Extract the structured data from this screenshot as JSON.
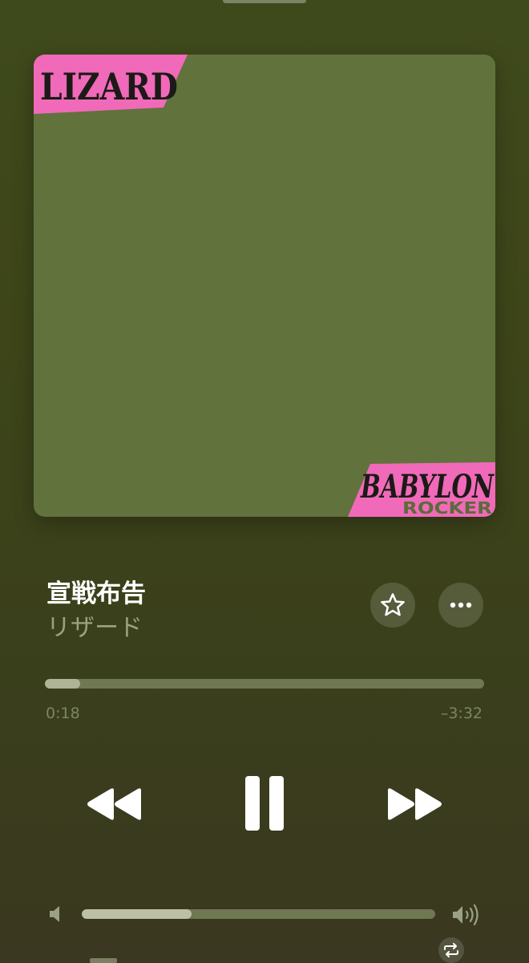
{
  "track": {
    "title": "宣戦布告",
    "artist": "リザード"
  },
  "artwork": {
    "top_label": "LIZARD",
    "bottom_label_1": "BABYLON",
    "bottom_label_2": "ROCKER",
    "background_color": "#61723c",
    "accent_color": "#f06ab9",
    "ink_color": "#1c1a17"
  },
  "playback": {
    "elapsed": "0:18",
    "remaining": "–3:32",
    "progress_fraction": 0.08,
    "state": "playing"
  },
  "volume": {
    "level_fraction": 0.31
  },
  "icons": {
    "favorite": "star-icon",
    "more": "ellipsis-icon",
    "rewind": "rewind-icon",
    "pause": "pause-icon",
    "forward": "fast-forward-icon",
    "volume_min": "speaker-icon",
    "volume_max": "speaker-wave-icon",
    "repeat": "repeat-icon"
  },
  "colors": {
    "background": "#3f4a1c",
    "title": "#ffffff",
    "subtitle": "#9aa37f",
    "track": "#6f7753",
    "progress_fill": "#aeb495",
    "volume_fill": "#bcc0a4"
  }
}
